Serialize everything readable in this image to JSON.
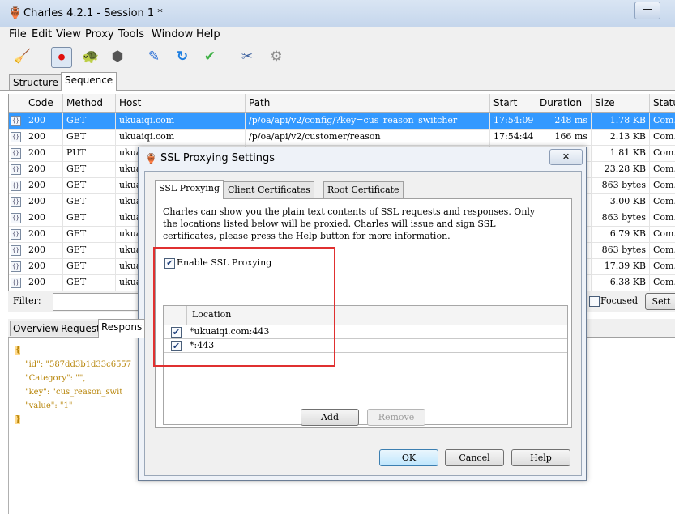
{
  "window": {
    "title": "Charles 4.2.1 - Session 1 *",
    "minimize": "—"
  },
  "menu": [
    "File",
    "Edit",
    "View",
    "Proxy",
    "Tools",
    "Window",
    "Help"
  ],
  "toolbar": {
    "icons": [
      "broom-icon",
      "record-icon",
      "turtle-icon",
      "stop-hexagon-icon",
      "pen-icon",
      "refresh-icon",
      "check-icon",
      "tools-icon",
      "settings-gear-icon"
    ],
    "glyphs": [
      "🧹",
      "⏺",
      "🐢",
      "⬢",
      "✎",
      "↻",
      "✔",
      "✂",
      "⚙"
    ]
  },
  "main_tabs": [
    "Structure",
    "Sequence"
  ],
  "table": {
    "columns": [
      "Code",
      "Method",
      "Host",
      "Path",
      "Start",
      "Duration",
      "Size",
      "Statu"
    ],
    "rows": [
      {
        "code": "200",
        "method": "GET",
        "host": "ukuaiqi.com",
        "path": "/p/oa/api/v2/config/?key=cus_reason_switcher",
        "start": "17:54:09",
        "duration": "248 ms",
        "size": "1.78 KB",
        "status": "Com..."
      },
      {
        "code": "200",
        "method": "GET",
        "host": "ukuaiqi.com",
        "path": "/p/oa/api/v2/customer/reason",
        "start": "17:54:44",
        "duration": "166 ms",
        "size": "2.13 KB",
        "status": "Com..."
      },
      {
        "code": "200",
        "method": "PUT",
        "host": "ukua",
        "path": "",
        "start": "",
        "duration": "",
        "size": "1.81 KB",
        "status": "Com..."
      },
      {
        "code": "200",
        "method": "GET",
        "host": "ukua",
        "path": "",
        "start": "",
        "duration": "",
        "size": "23.28 KB",
        "status": "Com..."
      },
      {
        "code": "200",
        "method": "GET",
        "host": "ukua",
        "path": "",
        "start": "",
        "duration": "",
        "size": "863 bytes",
        "status": "Com..."
      },
      {
        "code": "200",
        "method": "GET",
        "host": "ukua",
        "path": "",
        "start": "",
        "duration": "",
        "size": "3.00 KB",
        "status": "Com..."
      },
      {
        "code": "200",
        "method": "GET",
        "host": "ukua",
        "path": "",
        "start": "",
        "duration": "",
        "size": "863 bytes",
        "status": "Com..."
      },
      {
        "code": "200",
        "method": "GET",
        "host": "ukua",
        "path": "",
        "start": "",
        "duration": "",
        "size": "6.79 KB",
        "status": "Com..."
      },
      {
        "code": "200",
        "method": "GET",
        "host": "ukua",
        "path": "",
        "start": "",
        "duration": "",
        "size": "863 bytes",
        "status": "Com..."
      },
      {
        "code": "200",
        "method": "GET",
        "host": "ukua",
        "path": "",
        "start": "",
        "duration": "",
        "size": "17.39 KB",
        "status": "Com..."
      },
      {
        "code": "200",
        "method": "GET",
        "host": "ukua",
        "path": "",
        "start": "",
        "duration": "",
        "size": "6.38 KB",
        "status": "Com..."
      }
    ]
  },
  "filter": {
    "label": "Filter:",
    "value": "",
    "focused_label": "Focused",
    "settings_label": "Sett"
  },
  "bottom_tabs": [
    "Overview",
    "Request",
    "Respons"
  ],
  "response_json": {
    "open": "{",
    "lines": [
      {
        "key": "\"id\"",
        "rest": ": \"587dd3b1d33c6557"
      },
      {
        "key": "\"Category\"",
        "rest": ": \"\","
      },
      {
        "key": "\"key\"",
        "rest": ": \"cus_reason_swit"
      },
      {
        "key": "\"value\"",
        "rest": ": \"1\""
      }
    ],
    "close": "}"
  },
  "dialog": {
    "title": "SSL Proxying Settings",
    "close": "✕",
    "tabs": [
      "SSL Proxying",
      "Client Certificates",
      "Root Certificate"
    ],
    "description": [
      "Charles can show you the plain text contents of SSL requests and responses.  Only",
      "the locations listed below will be proxied. Charles will issue and sign SSL",
      "certificates, please press the Help button for more information."
    ],
    "enable_label": "Enable SSL Proxying",
    "enable_checked": true,
    "location_header": "Location",
    "locations": [
      {
        "text": "*ukuaiqi.com:443",
        "checked": true
      },
      {
        "text": "*:443",
        "checked": true
      }
    ],
    "add": "Add",
    "remove": "Remove",
    "ok": "OK",
    "cancel": "Cancel",
    "help": "Help"
  },
  "colors": {
    "selection": "#3399ff",
    "highlight_box": "#e03030"
  }
}
